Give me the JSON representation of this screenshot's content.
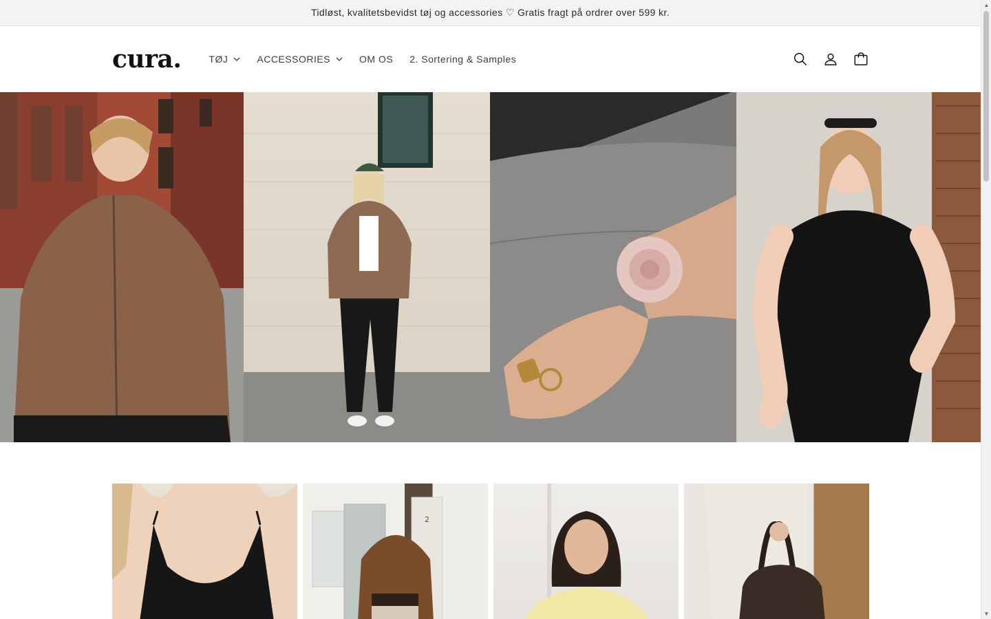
{
  "announcement": {
    "text": "Tidløst, kvalitetsbevidst tøj og accessories ♡ Gratis fragt på ordrer over 599 kr."
  },
  "header": {
    "logo": "cura.",
    "nav": [
      {
        "label": "TØJ",
        "has_dropdown": true
      },
      {
        "label": "ACCESSORIES",
        "has_dropdown": true
      },
      {
        "label": "OM OS",
        "has_dropdown": false
      },
      {
        "label": "2. Sortering & Samples",
        "has_dropdown": false
      }
    ],
    "icons": [
      "search-icon",
      "account-icon",
      "cart-icon"
    ]
  },
  "hero": {
    "tiles": [
      {
        "subject": "woman in brown fleece jacket on brick street"
      },
      {
        "subject": "woman in green cap and brown fleece by stone wall"
      },
      {
        "subject": "hand with pink satin flower scrunchie and gold rings"
      },
      {
        "subject": "woman in black sleeveless top by white wall"
      }
    ]
  },
  "products": [
    {
      "subject": "black camisole top"
    },
    {
      "subject": "long curly hair, brown top"
    },
    {
      "subject": "yellow knit sweater"
    },
    {
      "subject": "brown suede bag"
    }
  ],
  "colors": {
    "announcement_bg": "#f3f3f3",
    "text": "#121212",
    "nav_text": "#3c3c3c"
  }
}
